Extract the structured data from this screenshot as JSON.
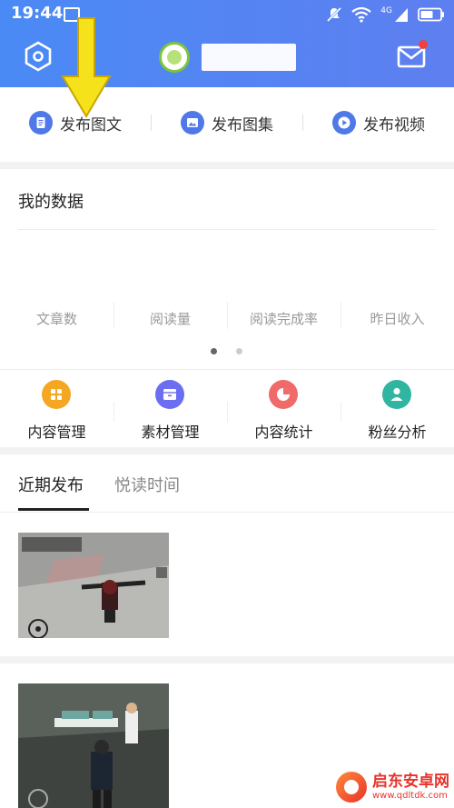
{
  "status_bar": {
    "time": "19:44",
    "network": "4G"
  },
  "header": {
    "accent": "#4a8af5",
    "badge_color": "#f24040"
  },
  "publish": {
    "items": [
      {
        "label": "发布图文",
        "icon": "article-icon"
      },
      {
        "label": "发布图集",
        "icon": "gallery-icon"
      },
      {
        "label": "发布视频",
        "icon": "video-play-icon"
      }
    ],
    "icon_color": "#4f78e8"
  },
  "annotation": {
    "arrow_color": "#f5e21a"
  },
  "my_data": {
    "title": "我的数据",
    "stats": [
      "文章数",
      "阅读量",
      "阅读完成率",
      "昨日收入"
    ],
    "page_indicator": {
      "pages": 2,
      "current": 1
    }
  },
  "tools": [
    {
      "label": "内容管理",
      "color": "#f5a623",
      "icon": "grid-icon"
    },
    {
      "label": "素材管理",
      "color": "#6b6ef0",
      "icon": "folder-icon"
    },
    {
      "label": "内容统计",
      "color": "#f06a6a",
      "icon": "pie-chart-icon"
    },
    {
      "label": "粉丝分析",
      "color": "#2fb5a0",
      "icon": "user-icon"
    }
  ],
  "tabs": [
    {
      "label": "近期发布",
      "active": true
    },
    {
      "label": "悦读时间",
      "active": false
    }
  ],
  "watermark": {
    "name": "启东安卓网",
    "url": "www.qdltdk.com"
  }
}
